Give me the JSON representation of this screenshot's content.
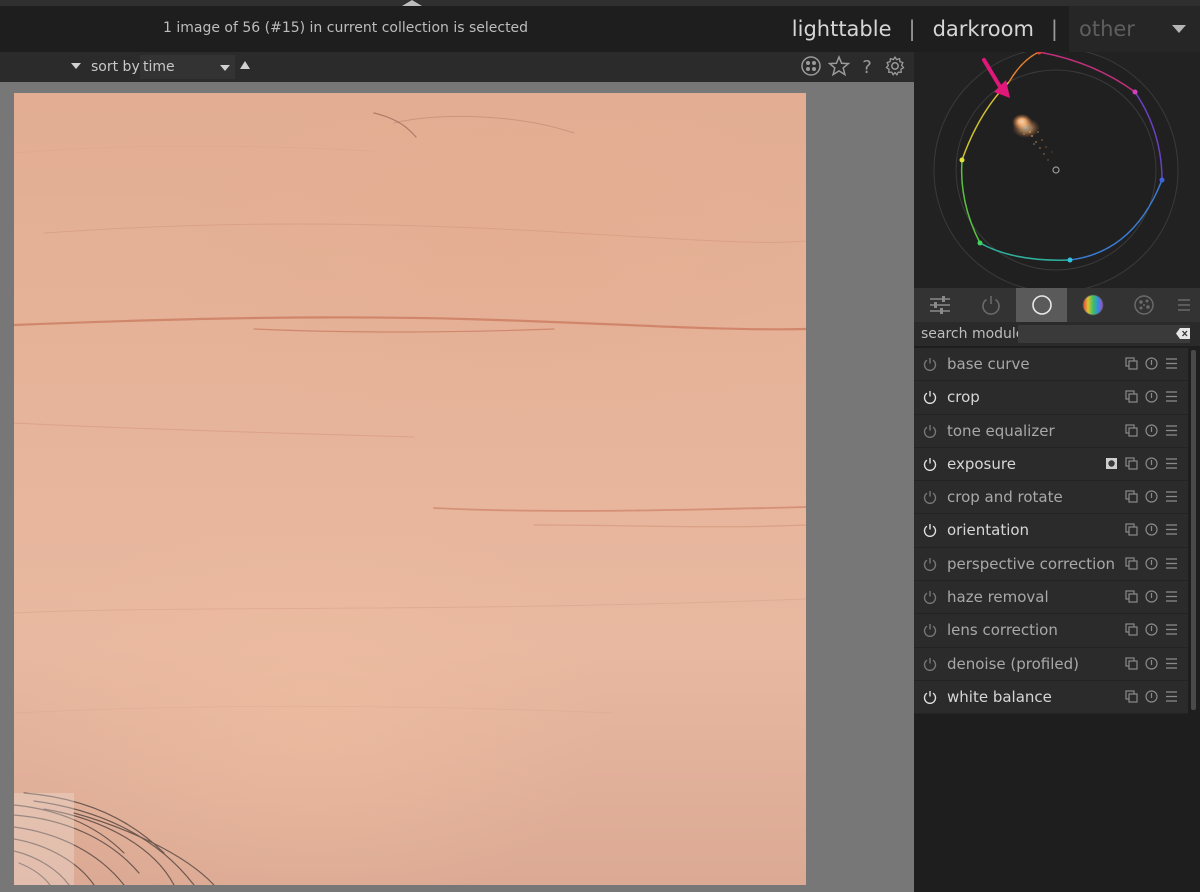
{
  "header": {
    "status": "1 image of 56 (#15) in current collection is selected",
    "views": [
      {
        "label": "lighttable",
        "active": true
      },
      {
        "label": "darkroom",
        "active": false
      }
    ],
    "separator": "|",
    "other_label": "other"
  },
  "toolbar": {
    "sort_label": "sort by",
    "sort_value": "time",
    "icons": [
      "overlay-icon",
      "star-icon",
      "help-icon",
      "gear-icon"
    ]
  },
  "panel": {
    "tabs": [
      "quick-access-icon",
      "active-modules-icon",
      "base-group-icon",
      "color-group-icon",
      "effects-group-icon",
      "module-menu-icon"
    ],
    "active_tab_index": 2,
    "search_label": "search module",
    "search_value": "",
    "modules": [
      {
        "label": "base curve",
        "enabled": false,
        "mask": false
      },
      {
        "label": "crop",
        "enabled": true,
        "mask": false
      },
      {
        "label": "tone equalizer",
        "enabled": false,
        "mask": false
      },
      {
        "label": "exposure",
        "enabled": true,
        "mask": true
      },
      {
        "label": "crop and rotate",
        "enabled": false,
        "mask": false
      },
      {
        "label": "orientation",
        "enabled": true,
        "mask": false
      },
      {
        "label": "perspective correction",
        "enabled": false,
        "mask": false
      },
      {
        "label": "haze removal",
        "enabled": false,
        "mask": false
      },
      {
        "label": "lens correction",
        "enabled": false,
        "mask": false
      },
      {
        "label": "denoise (profiled)",
        "enabled": false,
        "mask": false
      },
      {
        "label": "white balance",
        "enabled": true,
        "mask": false
      }
    ]
  },
  "colors": {
    "accent_arrow": "#e0187a",
    "background": "#1e1e1e",
    "canvas": "#777777",
    "skin": "#e4b098"
  }
}
